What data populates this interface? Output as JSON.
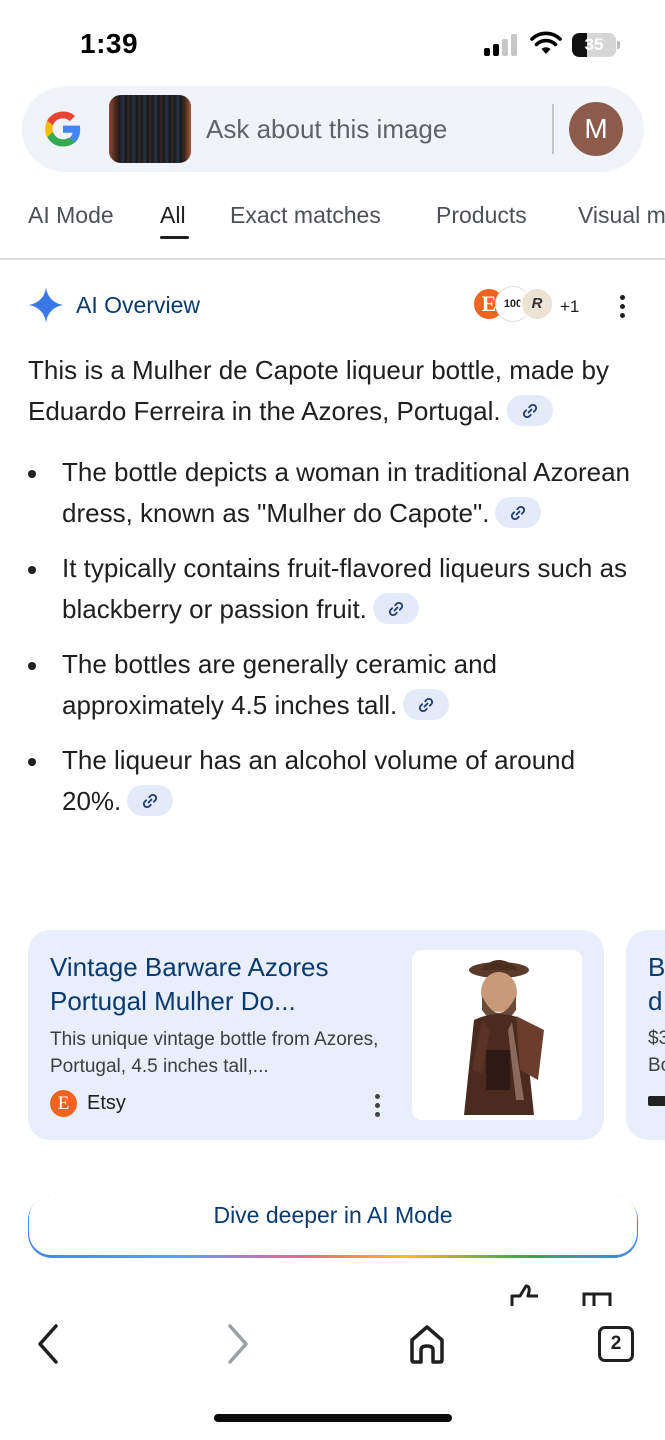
{
  "status_bar": {
    "time": "1:39",
    "battery": "35"
  },
  "search": {
    "placeholder": "Ask about this image",
    "avatar_letter": "M"
  },
  "tabs": [
    {
      "label": "AI Mode"
    },
    {
      "label": "All",
      "active": true
    },
    {
      "label": "Exact matches"
    },
    {
      "label": "Products"
    },
    {
      "label": "Visual m"
    }
  ],
  "ai_overview": {
    "title": "AI Overview",
    "source_badges": {
      "extra_count": "+1",
      "mid_badge": "100",
      "last_badge": "R"
    },
    "intro": "This is a Mulher de Capote liqueur bottle, made by Eduardo Ferreira in the Azores, Portugal.",
    "bullets": [
      "The bottle depicts a woman in traditional Azorean dress, known as \"Mulher do Capote\".",
      "It typically contains fruit-flavored liqueurs such as blackberry or passion fruit.",
      "The bottles are generally ceramic and approximately 4.5 inches tall.",
      "The liqueur has an alcohol volume of around 20%."
    ]
  },
  "source_card": {
    "title": "Vintage Barware Azores Portugal Mulher Do...",
    "snippet": "This unique vintage bottle from Azores, Portugal, 4.5 inches tall,...",
    "source_name": "Etsy",
    "source_letter": "E"
  },
  "next_card": {
    "line1": "B",
    "line2": "d",
    "line3": "$3",
    "line4": "Bo"
  },
  "dive_deeper": {
    "label": "Dive deeper in AI Mode"
  },
  "bottom_nav": {
    "tab_count": "2"
  },
  "colors": {
    "accent_blue": "#0b3a6e",
    "link_chip_bg": "#e3ebfa",
    "card_bg": "#e8eefb",
    "etsy_orange": "#f1641e",
    "avatar_bg": "#8d5b4c"
  }
}
